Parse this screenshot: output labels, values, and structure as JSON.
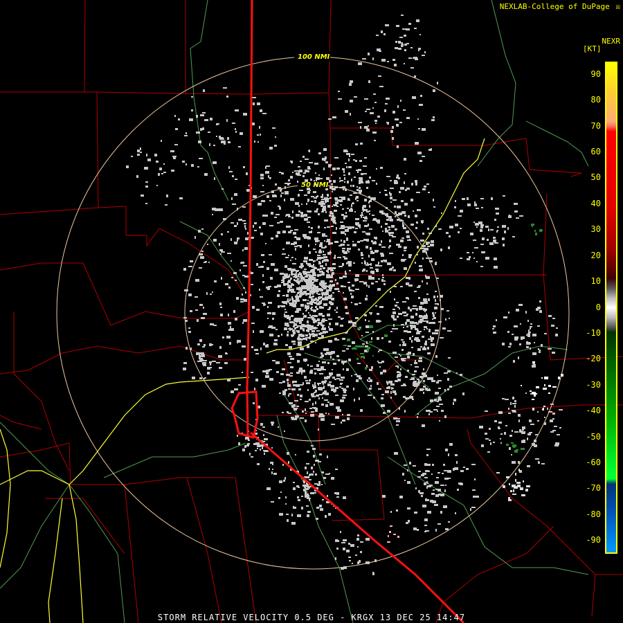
{
  "header": {
    "credit": "NEXLAB-College of DuPage",
    "credit_logo": "☒",
    "product": "NEXR",
    "unit": "[KT]"
  },
  "rings": [
    {
      "label": "100 NMI",
      "range_nmi": 100
    },
    {
      "label": "50 NMI",
      "range_nmi": 50
    }
  ],
  "legend": {
    "ticks": [
      {
        "label": "90",
        "value": 90
      },
      {
        "label": "80",
        "value": 80
      },
      {
        "label": "70",
        "value": 70
      },
      {
        "label": "60",
        "value": 60
      },
      {
        "label": "50",
        "value": 50
      },
      {
        "label": "40",
        "value": 40
      },
      {
        "label": "30",
        "value": 30
      },
      {
        "label": "20",
        "value": 20
      },
      {
        "label": "10",
        "value": 10
      },
      {
        "label": "0",
        "value": 0
      },
      {
        "label": "-10",
        "value": -10
      },
      {
        "label": "-20",
        "value": -20
      },
      {
        "label": "-30",
        "value": -30
      },
      {
        "label": "-40",
        "value": -40
      },
      {
        "label": "-50",
        "value": -50
      },
      {
        "label": "-60",
        "value": -60
      },
      {
        "label": "-70",
        "value": -70
      },
      {
        "label": "-80",
        "value": -80
      },
      {
        "label": "-90",
        "value": -90
      }
    ],
    "range": [
      -95,
      95
    ]
  },
  "colors": {
    "background": "#000000",
    "county_lines": "#cc0000",
    "state_lines": "#ff0000",
    "highways": "#ffff33",
    "roads": "#66cc66",
    "rivers": "#66cc66",
    "rings": "#f0c8a0",
    "echo_gray": "#c8c8c8",
    "text": "#ffff00"
  },
  "footer": {
    "text": "STORM RELATIVE VELOCITY 0.5 DEG - KRGX 13 DEC 25 14:47"
  }
}
